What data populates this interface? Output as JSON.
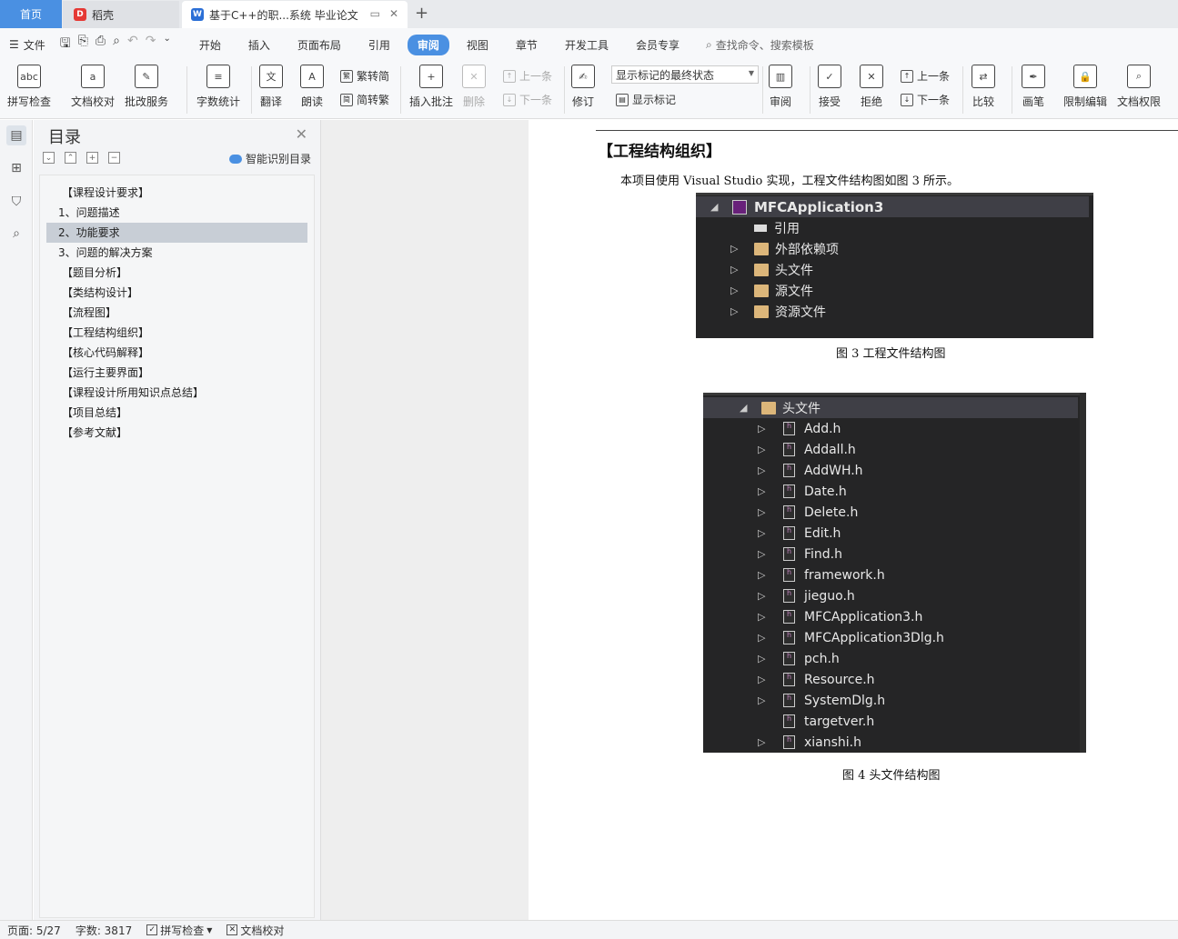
{
  "tabs": {
    "home": "首页",
    "daoke": "稻壳",
    "document": "基于C++的职...系统 毕业论文"
  },
  "menubar": {
    "file": "文件",
    "items": [
      "开始",
      "插入",
      "页面布局",
      "引用",
      "审阅",
      "视图",
      "章节",
      "开发工具",
      "会员专享"
    ],
    "active": "审阅",
    "search": "查找命令、搜索模板"
  },
  "ribbon": {
    "spell_check": "拼写检查",
    "doc_proof": "文档校对",
    "batch_service": "批改服务",
    "word_count": "字数统计",
    "translate": "翻译",
    "read_aloud": "朗读",
    "trad_to_simp": "繁转简",
    "simp_to_trad": "简转繁",
    "insert_comment": "插入批注",
    "delete": "删除",
    "prev": "上一条",
    "next": "下一条",
    "track": "修订",
    "markup_state": "显示标记的最终状态",
    "show_markup": "显示标记",
    "review": "审阅",
    "accept": "接受",
    "reject": "拒绝",
    "prev2": "上一条",
    "next2": "下一条",
    "compare": "比较",
    "pen": "画笔",
    "restrict_edit": "限制编辑",
    "doc_rights": "文档权限"
  },
  "toc": {
    "title": "目录",
    "smart": "智能识别目录",
    "items": [
      {
        "label": "【课程设计要求】",
        "level": 1
      },
      {
        "label": "1、问题描述",
        "level": 2
      },
      {
        "label": "2、功能要求",
        "level": 2,
        "selected": true
      },
      {
        "label": "3、问题的解决方案",
        "level": 2
      },
      {
        "label": "【题目分析】",
        "level": 1
      },
      {
        "label": "【类结构设计】",
        "level": 1
      },
      {
        "label": "【流程图】",
        "level": 1
      },
      {
        "label": "【工程结构组织】",
        "level": 1
      },
      {
        "label": "【核心代码解释】",
        "level": 1
      },
      {
        "label": "【运行主要界面】",
        "level": 1
      },
      {
        "label": "【课程设计所用知识点总结】",
        "level": 1
      },
      {
        "label": "【项目总结】",
        "level": 1
      },
      {
        "label": "【参考文献】",
        "level": 1
      }
    ]
  },
  "document": {
    "heading": "【工程结构组织】",
    "paragraph": "本项目使用 Visual Studio 实现，工程文件结构图如图 3 所示。",
    "fig3": {
      "caption": "图 3  工程文件结构图",
      "project": "MFCApplication3",
      "items": [
        "引用",
        "外部依赖项",
        "头文件",
        "源文件",
        "资源文件"
      ]
    },
    "fig4": {
      "caption": "图 4  头文件结构图",
      "folder": "头文件",
      "files": [
        "Add.h",
        "Addall.h",
        "AddWH.h",
        "Date.h",
        "Delete.h",
        "Edit.h",
        "Find.h",
        "framework.h",
        "jieguo.h",
        "MFCApplication3.h",
        "MFCApplication3Dlg.h",
        "pch.h",
        "Resource.h",
        "SystemDlg.h",
        "targetver.h",
        "xianshi.h"
      ]
    }
  },
  "status": {
    "page": "页面: 5/27",
    "words": "字数: 3817",
    "spell": "拼写检查",
    "proof": "文档校对"
  }
}
